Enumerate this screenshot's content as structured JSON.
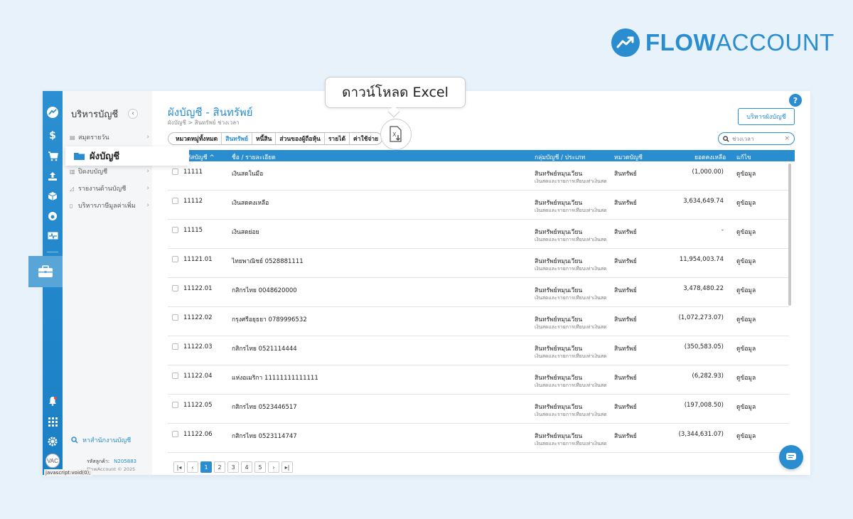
{
  "brand": {
    "part1": "FLOW",
    "part2": "ACCOUNT",
    "color": "#2a8dcf"
  },
  "sidebar": {
    "title": "บริหารบัญชี",
    "items": [
      {
        "label": "สมุดรายวัน",
        "icon": "book-icon"
      },
      {
        "label": "ผังบัญชี",
        "icon": "folder-icon"
      },
      {
        "label": "ปิดงบบัญชี",
        "icon": "chart-icon"
      },
      {
        "label": "รายงานด้านบัญชี",
        "icon": "report-icon"
      },
      {
        "label": "บริหารภาษีมูลค่าเพิ่ม",
        "icon": "document-icon"
      }
    ],
    "active_item": "ผังบัญชี",
    "search_label": "หาสำนักงานบัญชี",
    "customer_id_label": "รหัสลูกค้า:",
    "customer_id": "N205883",
    "copyright": "FlowAccount © 2025"
  },
  "header": {
    "title": "ผังบัญชี - สินทรัพย์",
    "breadcrumb": "ผังบัญชี > สินทรัพย์ ช่วงเวลา",
    "manage_button": "บริหารผังบัญชี",
    "help": "?"
  },
  "tabs": [
    "หมวดหมู่ทั้งหมด",
    "สินทรัพย์",
    "หนี้สิน",
    "ส่วนของผู้ถือหุ้น",
    "รายได้",
    "ค่าใช้จ่าย"
  ],
  "active_tab": "สินทรัพย์",
  "search": {
    "placeholder": "ช่วงเวลา"
  },
  "tooltip": {
    "text": "ดาวน์โหลด Excel"
  },
  "table": {
    "columns": [
      "รหัสบัญชี ^",
      "ชื่อ / รายละเอียด",
      "กลุ่มบัญชี / ประเภท",
      "หมวดบัญชี",
      "ยอดคงเหลือ",
      "แก้ไข"
    ],
    "rows": [
      {
        "code": "11111",
        "name": "เงินสดในมือ",
        "group": "สินทรัพย์หมุนเวียน",
        "group_sub": "เงินสดและรายการเทียบเท่าเงินสด",
        "category": "สินทรัพย์",
        "balance": "(1,000.00)",
        "action": "ดูข้อมูล"
      },
      {
        "code": "11112",
        "name": "เงินสดคงเหลือ",
        "group": "สินทรัพย์หมุนเวียน",
        "group_sub": "เงินสดและรายการเทียบเท่าเงินสด",
        "category": "สินทรัพย์",
        "balance": "3,634,649.74",
        "action": "ดูข้อมูล"
      },
      {
        "code": "11115",
        "name": "เงินสดย่อย",
        "group": "สินทรัพย์หมุนเวียน",
        "group_sub": "เงินสดและรายการเทียบเท่าเงินสด",
        "category": "สินทรัพย์",
        "balance": "-",
        "action": "ดูข้อมูล"
      },
      {
        "code": "11121.01",
        "name": "ไทยพาณิชย์ 0528881111",
        "group": "สินทรัพย์หมุนเวียน",
        "group_sub": "เงินสดและรายการเทียบเท่าเงินสด",
        "category": "สินทรัพย์",
        "balance": "11,954,003.74",
        "action": "ดูข้อมูล"
      },
      {
        "code": "11122.01",
        "name": "กสิกรไทย 0048620000",
        "group": "สินทรัพย์หมุนเวียน",
        "group_sub": "เงินสดและรายการเทียบเท่าเงินสด",
        "category": "สินทรัพย์",
        "balance": "3,478,480.22",
        "action": "ดูข้อมูล"
      },
      {
        "code": "11122.02",
        "name": "กรุงศรีอยุธยา 0789996532",
        "group": "สินทรัพย์หมุนเวียน",
        "group_sub": "เงินสดและรายการเทียบเท่าเงินสด",
        "category": "สินทรัพย์",
        "balance": "(1,072,273.07)",
        "action": "ดูข้อมูล"
      },
      {
        "code": "11122.03",
        "name": "กสิกรไทย 0521114444",
        "group": "สินทรัพย์หมุนเวียน",
        "group_sub": "เงินสดและรายการเทียบเท่าเงินสด",
        "category": "สินทรัพย์",
        "balance": "(350,583.05)",
        "action": "ดูข้อมูล"
      },
      {
        "code": "11122.04",
        "name": "แห่งอเมริกา 11111111111111",
        "group": "สินทรัพย์หมุนเวียน",
        "group_sub": "เงินสดและรายการเทียบเท่าเงินสด",
        "category": "สินทรัพย์",
        "balance": "(6,282.93)",
        "action": "ดูข้อมูล"
      },
      {
        "code": "11122.05",
        "name": "กสิกรไทย 0523446517",
        "group": "สินทรัพย์หมุนเวียน",
        "group_sub": "เงินสดและรายการเทียบเท่าเงินสด",
        "category": "สินทรัพย์",
        "balance": "(197,008.50)",
        "action": "ดูข้อมูล"
      },
      {
        "code": "11122.06",
        "name": "กสิกรไทย 0523114747",
        "group": "สินทรัพย์หมุนเวียน",
        "group_sub": "เงินสดและรายการเทียบเท่าเงินสด",
        "category": "สินทรัพย์",
        "balance": "(3,344,631.07)",
        "action": "ดูข้อมูล"
      }
    ]
  },
  "pagination": {
    "first": "|◂",
    "prev": "‹",
    "pages": [
      "1",
      "2",
      "3",
      "4",
      "5"
    ],
    "current": "1",
    "next": "›",
    "last": "▸|"
  },
  "status_bar": {
    "url": "javascript:void(0);"
  },
  "avatar_text": "VAC"
}
